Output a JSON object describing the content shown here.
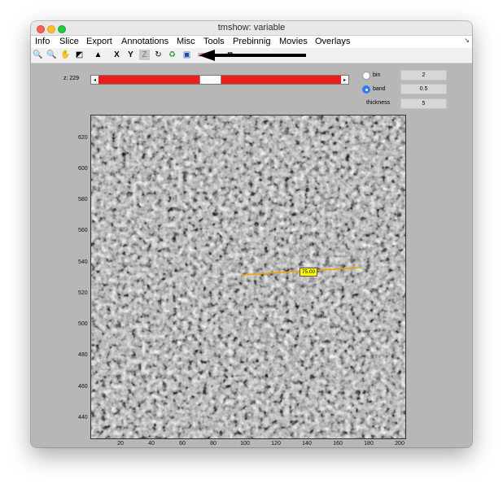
{
  "window": {
    "title": "tmshow: variable"
  },
  "menubar": {
    "items": [
      "Info",
      "Slice",
      "Export",
      "Annotations",
      "Misc",
      "Tools",
      "Prebinnig",
      "Movies",
      "Overlays"
    ],
    "corner_glyph": "↘"
  },
  "toolbar": {
    "icons": [
      {
        "name": "zoom-in-icon",
        "glyph": "🔍"
      },
      {
        "name": "zoom-out-icon",
        "glyph": "🔍"
      },
      {
        "name": "pan-hand-icon",
        "glyph": "✋"
      },
      {
        "name": "contrast-icon",
        "glyph": "◩"
      },
      {
        "name": "histogram-icon",
        "glyph": "▲"
      },
      {
        "name": "x-axis-button",
        "glyph": "X"
      },
      {
        "name": "y-axis-button",
        "glyph": "Y"
      },
      {
        "name": "z-axis-button",
        "glyph": "Z"
      },
      {
        "name": "rotate-icon",
        "glyph": "↻"
      },
      {
        "name": "recycle-icon",
        "glyph": "♻"
      },
      {
        "name": "monitor-icon",
        "glyph": "▣"
      },
      {
        "name": "measure-icon",
        "glyph": "▭"
      },
      {
        "name": "camera-icon",
        "glyph": "◙"
      }
    ]
  },
  "slice": {
    "label": "z: 229",
    "left_arrow": "◂",
    "right_arrow": "▸",
    "position": 0.45
  },
  "options": {
    "bin": {
      "label": "bin",
      "value": "2",
      "selected": false
    },
    "band": {
      "label": "band",
      "value": "0.5",
      "selected": true
    },
    "thickness": {
      "label": "thickness",
      "value": "5"
    }
  },
  "image_axes": {
    "y_ticks": [
      "620",
      "600",
      "580",
      "560",
      "540",
      "520",
      "500",
      "480",
      "460",
      "440"
    ],
    "x_ticks": [
      "20",
      "40",
      "60",
      "80",
      "100",
      "120",
      "140",
      "160",
      "180",
      "200"
    ]
  },
  "measurement": {
    "value": "75.00",
    "color": "#f0a000"
  },
  "colors": {
    "slider": "#ee1c1c",
    "window_bg": "#b7b7b7",
    "accent": "#2f7cf6"
  }
}
